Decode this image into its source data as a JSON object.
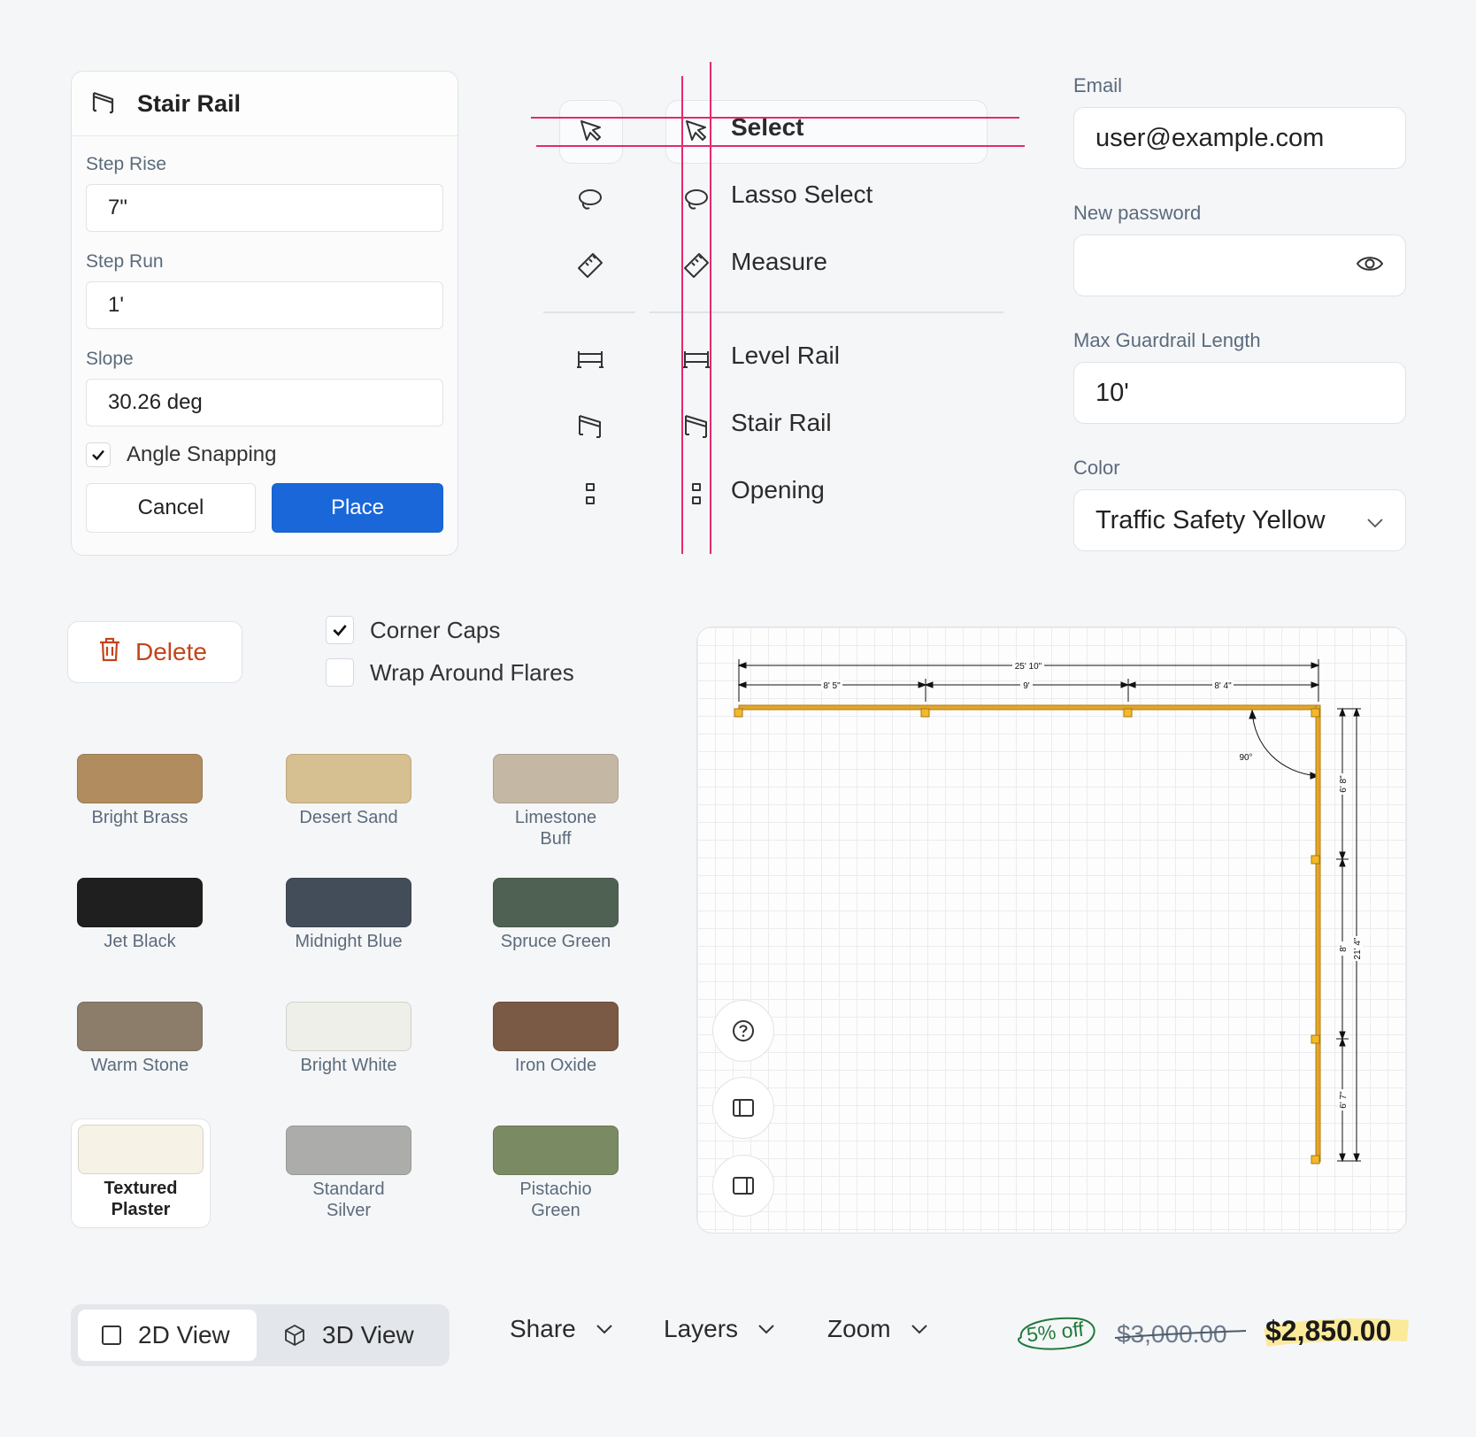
{
  "stair_panel": {
    "title": "Stair Rail",
    "step_rise_label": "Step Rise",
    "step_rise_value": "7\"",
    "step_run_label": "Step Run",
    "step_run_value": "1'",
    "slope_label": "Slope",
    "slope_value": "30.26 deg",
    "angle_snapping_label": "Angle Snapping",
    "angle_snapping_checked": true,
    "cancel_label": "Cancel",
    "place_label": "Place"
  },
  "tools": [
    {
      "label": "Select",
      "icon": "cursor-icon",
      "selected": true
    },
    {
      "label": "Lasso Select",
      "icon": "lasso-icon"
    },
    {
      "label": "Measure",
      "icon": "ruler-icon"
    },
    {
      "label": "Level Rail",
      "icon": "level-rail-icon"
    },
    {
      "label": "Stair Rail",
      "icon": "stair-rail-icon"
    },
    {
      "label": "Opening",
      "icon": "opening-icon"
    }
  ],
  "form": {
    "email_label": "Email",
    "email_value": "user@example.com",
    "password_label": "New password",
    "password_value": "",
    "max_length_label": "Max Guardrail Length",
    "max_length_value": "10'",
    "color_label": "Color",
    "color_value": "Traffic Safety Yellow"
  },
  "actions": {
    "delete_label": "Delete",
    "corner_caps_label": "Corner Caps",
    "corner_caps_checked": true,
    "wrap_flares_label": "Wrap Around Flares",
    "wrap_flares_checked": false
  },
  "swatches": [
    {
      "name": "Bright Brass",
      "color": "#b08c5e"
    },
    {
      "name": "Desert Sand",
      "color": "#d6bf90"
    },
    {
      "name": "Limestone Buff",
      "color": "#c4b8a5"
    },
    {
      "name": "Jet Black",
      "color": "#1f1f1f"
    },
    {
      "name": "Midnight Blue",
      "color": "#434d5a"
    },
    {
      "name": "Spruce Green",
      "color": "#4f6152"
    },
    {
      "name": "Warm Stone",
      "color": "#8b7d69"
    },
    {
      "name": "Bright White",
      "color": "#efefea"
    },
    {
      "name": "Iron Oxide",
      "color": "#7a5a44"
    },
    {
      "name": "Textured Plaster",
      "color": "#f6f2e6",
      "selected": true
    },
    {
      "name": "Standard Silver",
      "color": "#acacaa"
    },
    {
      "name": "Pistachio Green",
      "color": "#7a8a62"
    }
  ],
  "plan": {
    "total_top": "25' 10\"",
    "seg_top_1": "8' 5\"",
    "seg_top_2": "9'",
    "seg_top_3": "8' 4\"",
    "angle": "90°",
    "seg_right_1": "6' 8\"",
    "seg_right_2": "8'",
    "seg_right_3": "6' 7\"",
    "total_right": "21' 4\"",
    "rail_color": "#e3a52a"
  },
  "toolbar": {
    "view_2d": "2D View",
    "view_3d": "3D View",
    "active_view": "2D View",
    "share": "Share",
    "layers": "Layers",
    "zoom": "Zoom",
    "discount_badge": "5% off",
    "old_price": "$3,000.00",
    "new_price": "$2,850.00"
  }
}
